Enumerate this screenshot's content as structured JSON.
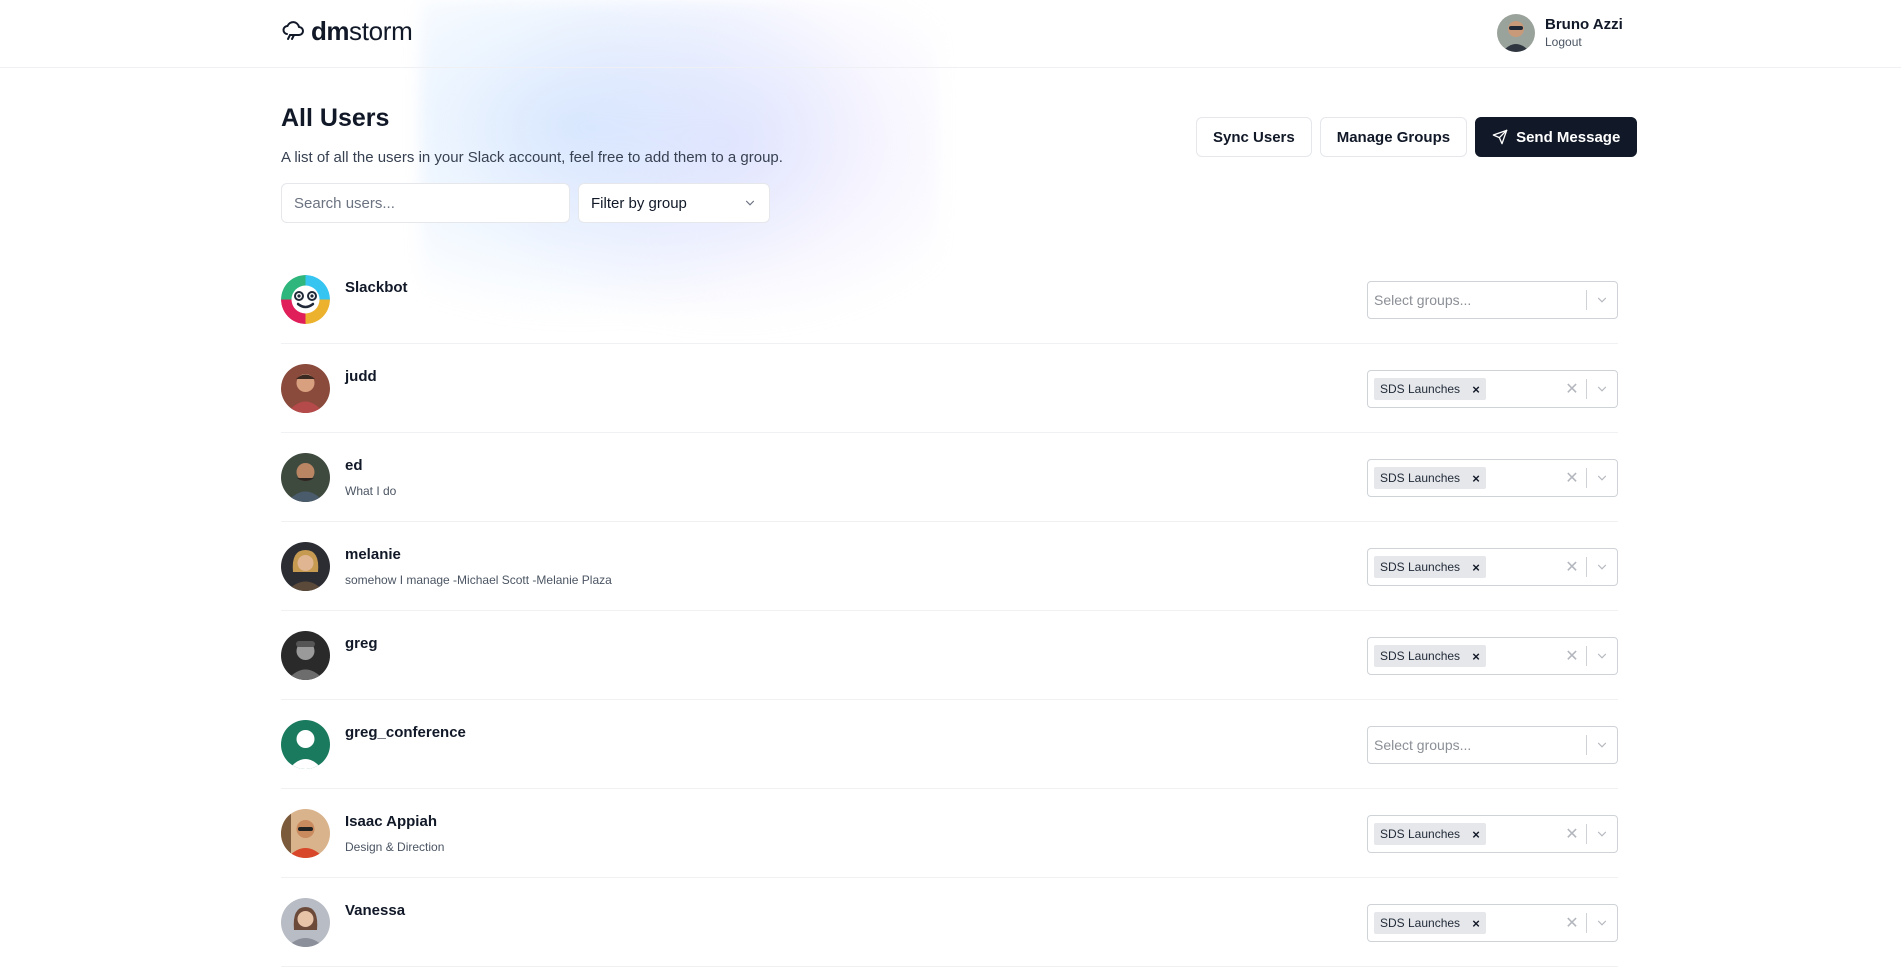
{
  "brand": {
    "bold": "dm",
    "light": "storm",
    "icon": "cloud-icon"
  },
  "account": {
    "name": "Bruno Azzi",
    "logout": "Logout"
  },
  "page": {
    "title": "All Users",
    "subtitle": "A list of all the users in your Slack account, feel free to add them to a group."
  },
  "actions": {
    "sync": "Sync Users",
    "manage": "Manage Groups",
    "send": "Send Message"
  },
  "search": {
    "placeholder": "Search users..."
  },
  "filter": {
    "label": "Filter by group"
  },
  "group_placeholder": "Select groups...",
  "users": [
    {
      "name": "Slackbot",
      "desc": "",
      "groups": []
    },
    {
      "name": "judd",
      "desc": "",
      "groups": [
        "SDS Launches"
      ]
    },
    {
      "name": "ed",
      "desc": "What I do",
      "groups": [
        "SDS Launches"
      ]
    },
    {
      "name": "melanie",
      "desc": "somehow I manage -Michael Scott -Melanie Plaza",
      "groups": [
        "SDS Launches"
      ]
    },
    {
      "name": "greg",
      "desc": "",
      "groups": [
        "SDS Launches"
      ]
    },
    {
      "name": "greg_conference",
      "desc": "",
      "groups": []
    },
    {
      "name": "Isaac Appiah",
      "desc": "Design & Direction",
      "groups": [
        "SDS Launches"
      ]
    },
    {
      "name": "Vanessa",
      "desc": "",
      "groups": [
        "SDS Launches"
      ]
    }
  ],
  "colors": {
    "primary": "#111827",
    "border": "#e5e7eb",
    "chip": "#e6e7ea"
  }
}
